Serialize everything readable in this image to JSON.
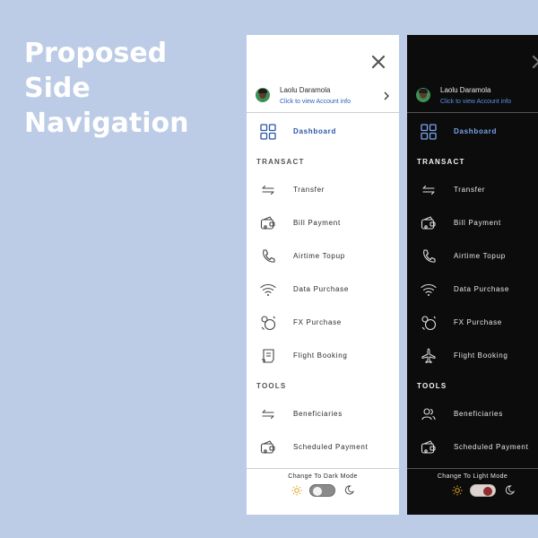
{
  "headline": [
    "Proposed",
    "Side",
    "Navigation"
  ],
  "account": {
    "name": "Laolu Daramola",
    "link": "Click to view Account info"
  },
  "sections": {
    "transact": "TRANSACT",
    "tools": "TOOLS"
  },
  "nav": {
    "dashboard": "Dashboard",
    "transfer": "Transfer",
    "bill_payment": "Bill Payment",
    "airtime_topup": "Airtime Topup",
    "data_purchase": "Data Purchase",
    "fx_purchase": "FX Purchase",
    "flight_booking": "Flight Booking",
    "beneficiaries": "Beneficiaries",
    "scheduled_payment": "Scheduled Payment"
  },
  "light_mode": {
    "label": "Change To Dark Mode",
    "toggle_on": false
  },
  "dark_mode": {
    "label": "Change To Light Mode",
    "toggle_on": true
  },
  "colors": {
    "background": "#bccbe6",
    "accent": "#2b55a6",
    "dark_panel": "#0c0c0c",
    "sun": "#e3a21a"
  }
}
